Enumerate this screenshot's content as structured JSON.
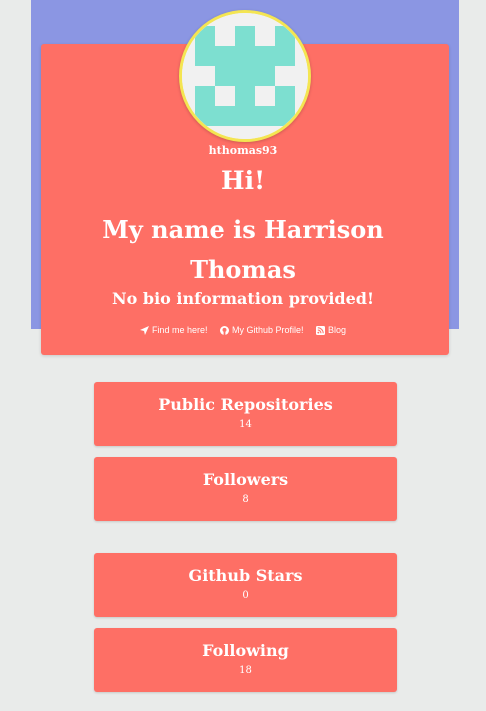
{
  "profile": {
    "username": "hthomas93",
    "greeting": "Hi!",
    "name_line": "My name is Harrison Thomas",
    "bio": "No bio information provided!",
    "avatar_color": "#7ddfd0"
  },
  "links": {
    "location": "Find me here!",
    "github": "My Github Profile!",
    "blog": "Blog"
  },
  "stats": [
    {
      "label": "Public Repositories",
      "value": "14"
    },
    {
      "label": "Followers",
      "value": "8"
    },
    {
      "label": "Github Stars",
      "value": "0"
    },
    {
      "label": "Following",
      "value": "18"
    }
  ],
  "colors": {
    "banner": "#8b96e3",
    "card": "#fe6f65",
    "background": "#e9ebea",
    "avatar_border": "#f4e552"
  }
}
